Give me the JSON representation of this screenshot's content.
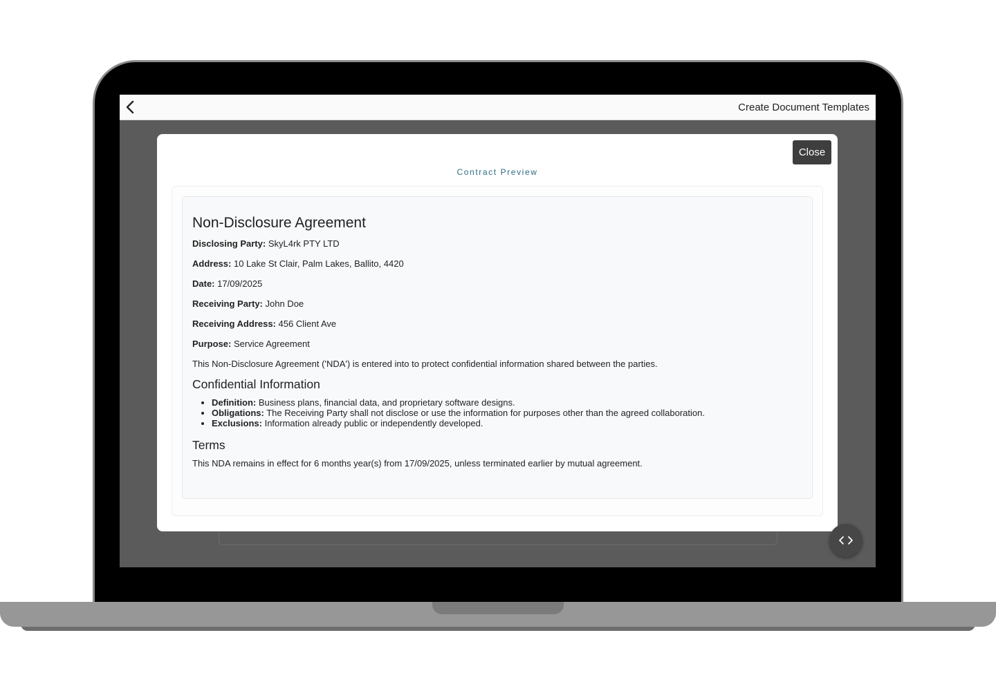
{
  "header": {
    "title": "Create Document Templates"
  },
  "modal": {
    "close_label": "Close",
    "title": "Contract Preview"
  },
  "document": {
    "title": "Non-Disclosure Agreement",
    "fields": [
      {
        "label": "Disclosing Party:",
        "value": "SkyL4rk PTY LTD"
      },
      {
        "label": "Address:",
        "value": "10 Lake St Clair, Palm Lakes, Ballito, 4420"
      },
      {
        "label": "Date:",
        "value": "17/09/2025"
      },
      {
        "label": "Receiving Party:",
        "value": "John Doe"
      },
      {
        "label": "Receiving Address:",
        "value": "456 Client Ave"
      },
      {
        "label": "Purpose:",
        "value": "Service Agreement"
      }
    ],
    "intro": "This Non-Disclosure Agreement ('NDA') is entered into to protect confidential information shared between the parties.",
    "confidential_heading": "Confidential Information",
    "confidential_items": [
      {
        "label": "Definition:",
        "text": "Business plans, financial data, and proprietary software designs."
      },
      {
        "label": "Obligations:",
        "text": "The Receiving Party shall not disclose or use the information for purposes other than the agreed collaboration."
      },
      {
        "label": "Exclusions:",
        "text": "Information already public or independently developed."
      }
    ],
    "terms_heading": "Terms",
    "terms_text": "This NDA remains in effect for 6 months year(s) from 17/09/2025, unless terminated earlier by mutual agreement."
  },
  "icons": {
    "back": "chevron-left-icon",
    "toggle": "code-brackets-icon"
  }
}
